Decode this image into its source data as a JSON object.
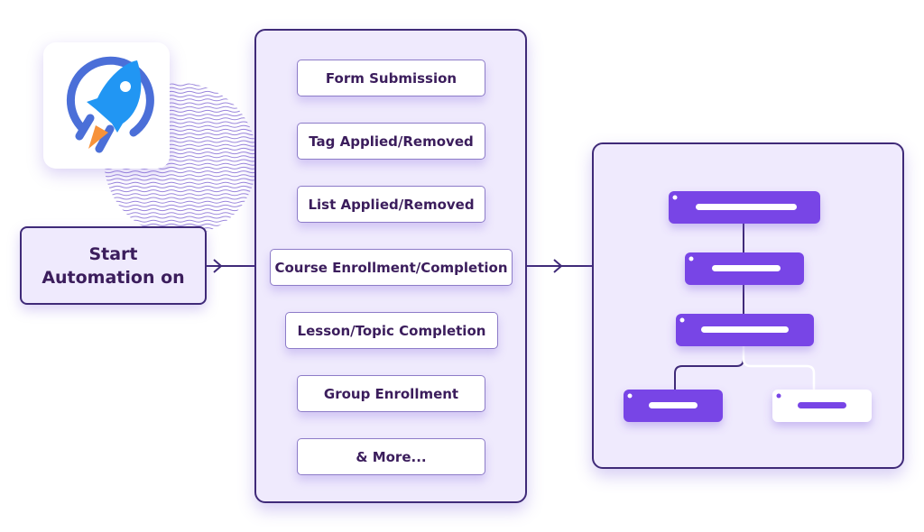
{
  "logo": {
    "icon": "rocket-icon",
    "colors": {
      "ring": "#4b6fd8",
      "rocket": "#2196f3",
      "flame": "#f7923a"
    }
  },
  "start": {
    "line1": "Start",
    "line2": "Automation on"
  },
  "triggers": [
    {
      "label": "Form Submission"
    },
    {
      "label": "Tag Applied/Removed"
    },
    {
      "label": "List Applied/Removed"
    },
    {
      "label": "Course Enrollment/Completion"
    },
    {
      "label": "Lesson/Topic Completion"
    },
    {
      "label": "Group Enrollment"
    },
    {
      "label": "& More..."
    }
  ],
  "flow": {
    "colors": {
      "node": "#7845e6",
      "node_alt": "#ffffff",
      "line": "#3f2a78"
    },
    "nodes": [
      {
        "style": "filled"
      },
      {
        "style": "filled"
      },
      {
        "style": "filled"
      },
      {
        "style": "filled"
      },
      {
        "style": "outline"
      }
    ]
  }
}
